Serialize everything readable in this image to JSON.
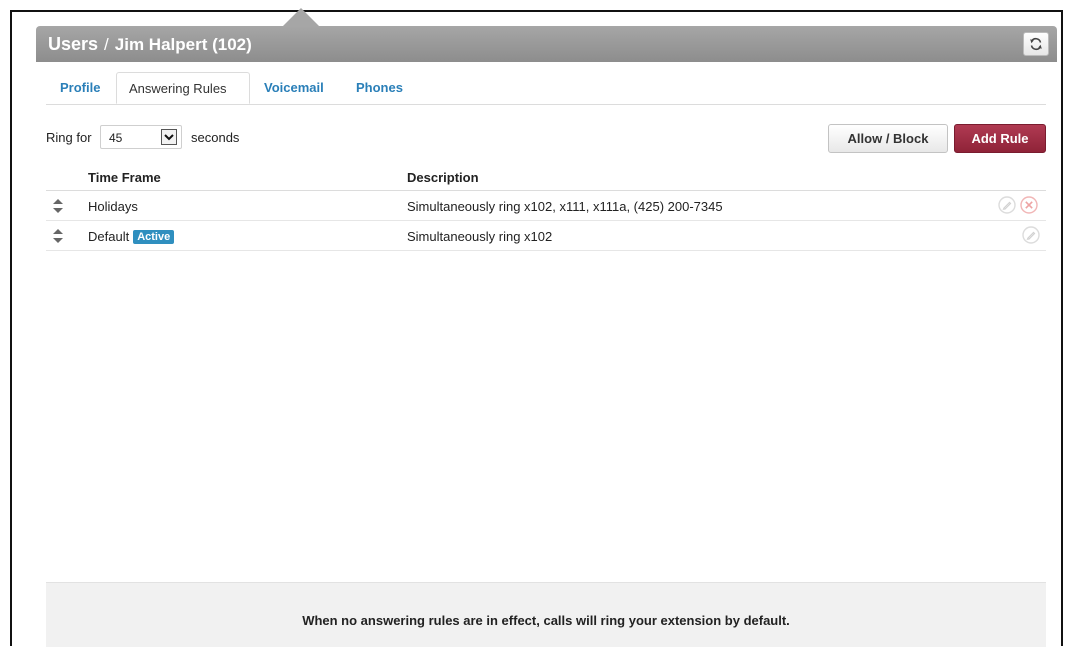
{
  "header": {
    "section": "Users",
    "separator": "/",
    "user": "Jim Halpert (102)",
    "refresh_icon": "refresh-icon"
  },
  "tabs": [
    {
      "label": "Profile",
      "active": false
    },
    {
      "label": "Answering Rules",
      "active": true
    },
    {
      "label": "Voicemail",
      "active": false
    },
    {
      "label": "Phones",
      "active": false
    }
  ],
  "ring": {
    "label": "Ring for",
    "value": "45",
    "unit": "seconds"
  },
  "buttons": {
    "allow_block": "Allow / Block",
    "add_rule": "Add Rule"
  },
  "table": {
    "columns": [
      "Time Frame",
      "Description"
    ],
    "rows": [
      {
        "time_frame": "Holidays",
        "badge": "",
        "description": "Simultaneously ring x102, x111, x111a, (425) 200-7345",
        "actions": [
          "edit-icon",
          "delete-icon"
        ]
      },
      {
        "time_frame": "Default",
        "badge": "Active",
        "description": "Simultaneously ring x102",
        "actions": [
          "edit-icon"
        ]
      }
    ]
  },
  "footer": {
    "message": "When no answering rules are in effect, calls will ring your extension by default."
  },
  "colors": {
    "header_bar": "#9a9a9a",
    "tab_link": "#2a7fb8",
    "add_rule": "#9e2d45",
    "badge": "#2f8fbf"
  }
}
